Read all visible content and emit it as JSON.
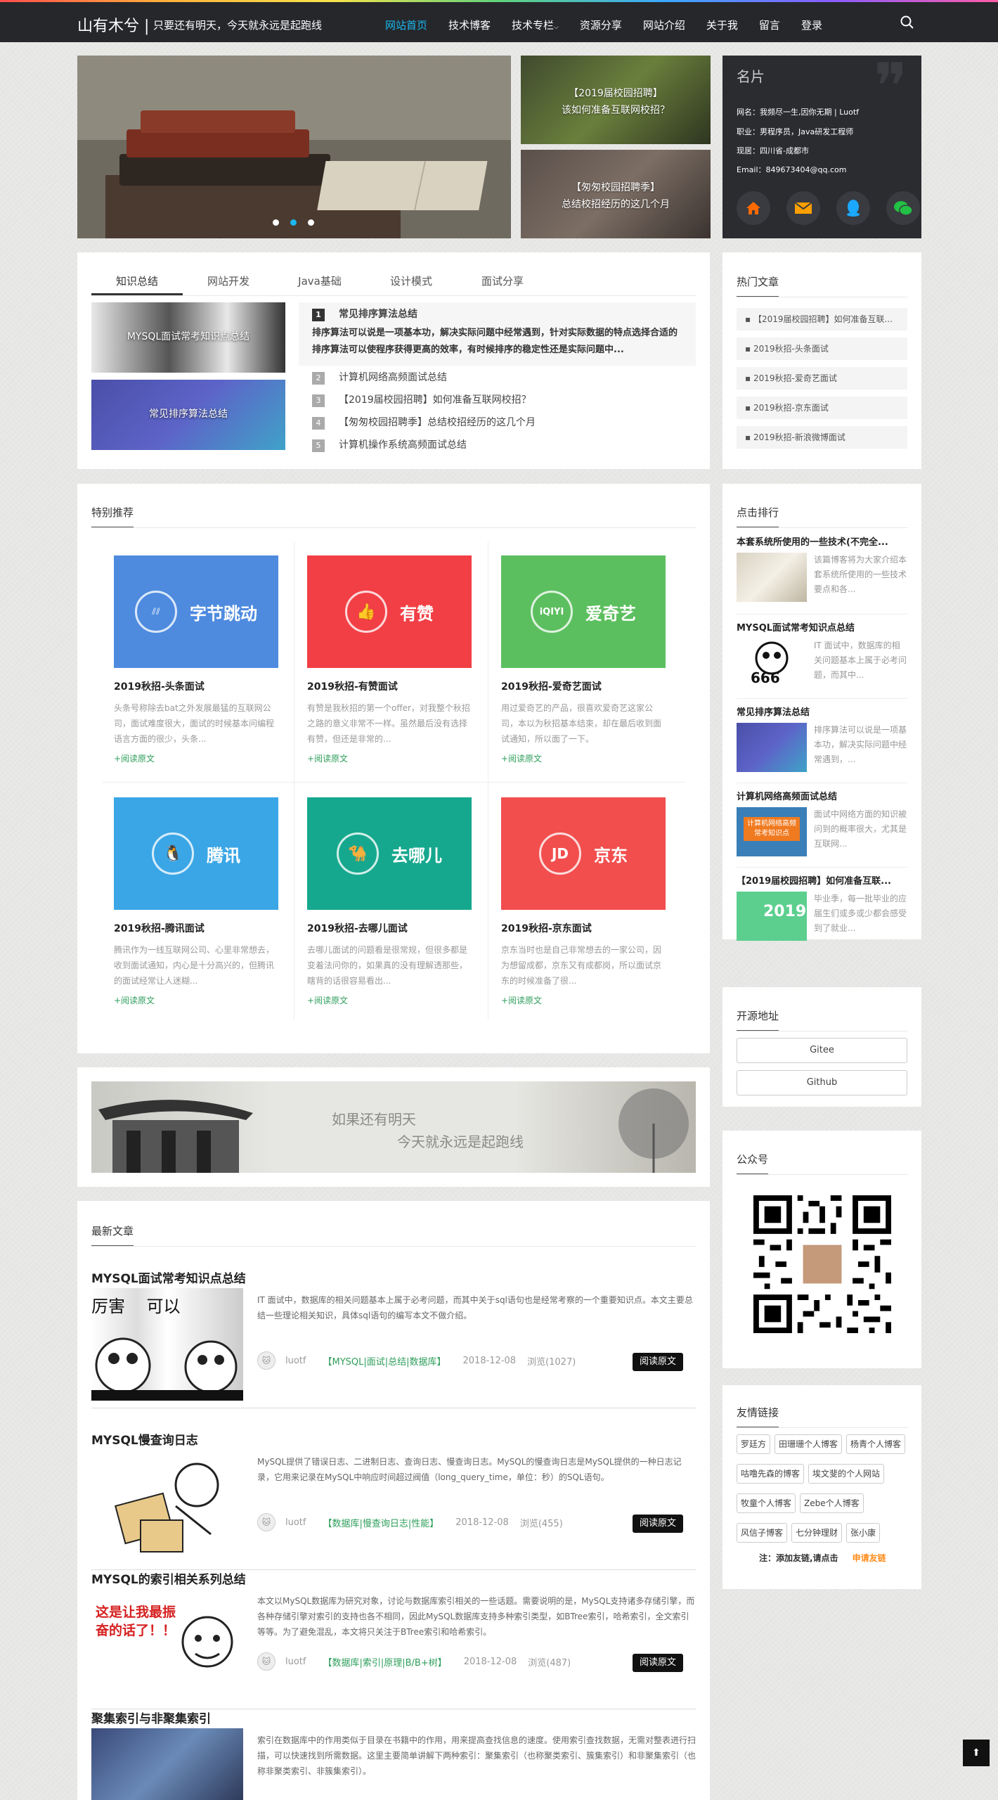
{
  "header": {
    "logo": "山有木兮 |",
    "slogan": "只要还有明天，今天就永远是起跑线",
    "nav": [
      "网站首页",
      "技术博客",
      "技术专栏",
      "资源分享",
      "网站介绍",
      "关于我",
      "留言",
      "登录"
    ],
    "nav_active": 0
  },
  "carousel": {
    "active_dot": 1,
    "dot_count": 3
  },
  "side_banners": [
    {
      "title": "【2019届校园招聘】",
      "sub": "该如何准备互联网校招？"
    },
    {
      "title": "【匆匆校园招聘季】",
      "sub": "总结校招经历的这几个月"
    }
  ],
  "card": {
    "title": "名片",
    "lines": [
      "网名：我频尽一生,因你无期 | Luotf",
      "职业：男程序员，Java研发工程师",
      "现居：四川省-成都市",
      "Email：849673404@qq.com"
    ],
    "icons": [
      "home-icon",
      "mail-icon",
      "qq-icon",
      "wechat-icon"
    ],
    "icon_colors": [
      "#ff6a00",
      "#ffa000",
      "#1ba8ff",
      "#22c044"
    ]
  },
  "tabs": [
    "知识总结",
    "网站开发",
    "Java基础",
    "设计模式",
    "面试分享"
  ],
  "tab_thumbs": [
    "MYSQL面试常考知识点总结",
    "常见排序算法总结"
  ],
  "hot_first": {
    "num": "1",
    "title": "常见排序算法总结",
    "desc": "排序算法可以说是一项基本功，解决实际问题中经常遇到，针对实际数据的特点选择合适的排序算法可以使程序获得更高的效率，有时候排序的稳定性还是实际问题中..."
  },
  "hot_items": [
    {
      "num": "2",
      "title": "计算机网络高频面试总结"
    },
    {
      "num": "3",
      "title": "【2019届校园招聘】如何准备互联网校招？"
    },
    {
      "num": "4",
      "title": "【匆匆校园招聘季】总结校招经历的这几个月"
    },
    {
      "num": "5",
      "title": "计算机操作系统高频面试总结"
    }
  ],
  "hot_articles": {
    "title": "热门文章",
    "items": [
      "【2019届校园招聘】如何准备互联...",
      "2019秋招-头条面试",
      "2019秋招-爱奇艺面试",
      "2019秋招-京东面试",
      "2019秋招-新浪微博面试"
    ]
  },
  "special": {
    "title": "特别推荐",
    "read_more": "+阅读原文",
    "items": [
      {
        "brand": "字节跳动",
        "mark": "字节跳动",
        "color": "#4e8bdf",
        "title": "2019秋招-头条面试",
        "desc": "头条号称除去bat之外发展最猛的互联网公司，面试难度很大，面试的时候基本问编程语言方面的很少，头条..."
      },
      {
        "brand": "有赞",
        "mark": "👍",
        "color": "#f23f45",
        "title": "2019秋招-有赞面试",
        "desc": "有赞是我秋招的第一个offer，对我整个秋招之路的意义非常不一样。虽然最后没有选择有赞，但还是非常的..."
      },
      {
        "brand": "爱奇艺",
        "mark": "iQIYI",
        "color": "#5cbf5f",
        "title": "2019秋招-爱奇艺面试",
        "desc": "用过爱奇艺的产品，很喜欢爱奇艺这家公司，本以为秋招基本结束，却在最后收到面试通知，所以面了一下。"
      },
      {
        "brand": "腾讯",
        "mark": "QQ",
        "color": "#3aa6e6",
        "title": "2019秋招-腾讯面试",
        "desc": "腾讯作为一线互联网公司、心里非常想去，收到面试通知，内心是十分高兴的，但腾讯的面试经常让人迷糊..."
      },
      {
        "brand": "去哪儿",
        "mark": "驼",
        "color": "#16a88e",
        "title": "2019秋招-去哪儿面试",
        "desc": "去哪儿面试的问题看是很常规，但很多都是变着法问你的，如果真的没有理解透那些，瞎背的话很容易看出..."
      },
      {
        "brand": "京东",
        "mark": "JD",
        "color": "#f24e4e",
        "title": "2019秋招-京东面试",
        "desc": "京东当时也是自己非常想去的一家公司，因为想留成都，京东又有成都岗，所以面试京东的时候准备了很..."
      }
    ]
  },
  "banner2": {
    "line1": "如果还有明天",
    "line2": "今天就永远是起跑线"
  },
  "latest": {
    "title": "最新文章",
    "read": "阅读原文",
    "items": [
      {
        "title": "MYSQL面试常考知识点总结",
        "desc": "IT 面试中，数据库的相关问题基本上属于必考问题，而其中关于sql语句也是经常考察的一个重要知识点。本文主要总结一些理论相关知识，具体sql语句的编写本文不做介绍。",
        "author": "luotf",
        "tags": "【MYSQL|面试|总结|数据库】",
        "date": "2018-12-08",
        "views": "浏览(1027)",
        "img_text": "厉害    可以"
      },
      {
        "title": "MYSQL慢查询日志",
        "desc": "MySQL提供了错误日志、二进制日志、查询日志、慢查询日志。MySQL的慢查询日志是MySQL提供的一种日志记录，它用来记录在MySQL中响应时间超过阀值（long_query_time，单位：秒）的SQL语句。",
        "author": "luotf",
        "tags": "【数据库|慢查询日志|性能】",
        "date": "2018-12-08",
        "views": "浏览(455)",
        "img_text": ""
      },
      {
        "title": "MYSQL的索引相关系列总结",
        "desc": "本文以MySQL数据库为研究对象，讨论与数据库索引相关的一些话题。需要说明的是，MySQL支持诸多存储引擎，而各种存储引擎对索引的支持也各不相同，因此MySQL数据库支持多种索引类型，如BTree索引，哈希索引，全文索引等等。为了避免混乱，本文将只关注于BTree索引和哈希索引。",
        "author": "luotf",
        "tags": "【数据库|索引|原理|B/B+树】",
        "date": "2018-12-08",
        "views": "浏览(487)",
        "img_text": "这是让我最振奋的话了！！"
      },
      {
        "title": "聚集索引与非聚集索引",
        "desc": "索引在数据库中的作用类似于目录在书籍中的作用，用来提高查找信息的速度。使用索引查找数据，无需对整表进行扫描，可以快速找到所需数据。这里主要简单讲解下两种索引：聚集索引（也称聚类索引、簇集索引）和非聚集索引（也称非聚类索引、非簇集索引）。",
        "author": "",
        "tags": "",
        "date": "",
        "views": "",
        "img_text": ""
      }
    ]
  },
  "click_rank": {
    "title": "点击排行",
    "items": [
      {
        "title": "本套系统所使用的一些技术(不完全...",
        "desc": "该篇博客将为大家介绍本套系统所使用的一些技术要点和各..."
      },
      {
        "title": "MYSQL面试常考知识点总结",
        "desc": "IT 面试中，数据库的相关问题基本上属于必考问题，而其中...",
        "img_text": "666"
      },
      {
        "title": "常见排序算法总结",
        "desc": "排序算法可以说是一项基本功，解决实际问题中经常遇到，..."
      },
      {
        "title": "计算机网络高频面试总结",
        "desc": "面试中网络方面的知识被问到的概率很大，尤其是互联网...",
        "img_text": "计算机网络高频 常考知识点"
      },
      {
        "title": "【2019届校园招聘】如何准备互联...",
        "desc": "毕业季，每一批毕业的应届生们或多或少都会感受到了就业...",
        "img_text": "2019"
      }
    ]
  },
  "open_source": {
    "title": "开源地址",
    "links": [
      "Gitee",
      "Github"
    ]
  },
  "wechat": {
    "title": "公众号"
  },
  "friends": {
    "title": "友情链接",
    "links": [
      "罗廷方",
      "田珊珊个人博客",
      "杨青个人博客",
      "咕噜先森的博客",
      "埃文斐的个人网站",
      "牧童个人博客",
      "Zebe个人博客",
      "风信子博客",
      "七分钟理财",
      "张小康"
    ],
    "note": "注：添加友链,请点击",
    "apply": "申请友链"
  },
  "totop": "⬆"
}
